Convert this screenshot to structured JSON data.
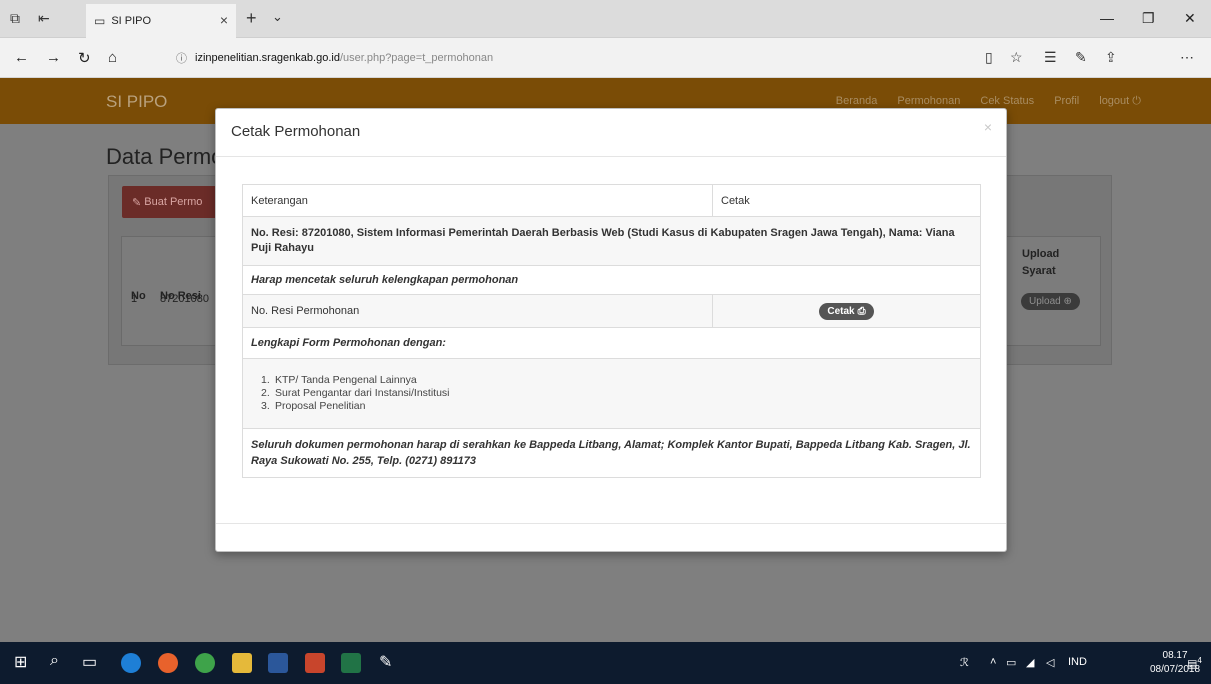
{
  "browser": {
    "tab_title": "SI PIPO",
    "url_host": "izinpenelitian.sragenkab.go.id",
    "url_path": "/user.php?page=t_permohonan"
  },
  "site": {
    "brand": "SI PIPO",
    "nav": [
      "Beranda",
      "Permohonan",
      "Cek Status",
      "Profil",
      "logout"
    ],
    "page_title": "Data Permo",
    "create_button": "Buat Permo",
    "table": {
      "headers": [
        "No",
        "No Resi",
        "Upload Syarat"
      ],
      "row": {
        "no": "1",
        "resi": "87201080"
      },
      "upload_button": "Upload"
    }
  },
  "modal": {
    "title": "Cetak Permohonan",
    "close": "×",
    "col_keterangan": "Keterangan",
    "col_cetak": "Cetak",
    "resi_line": "No. Resi: 87201080, Sistem Informasi Pemerintah Daerah Berbasis Web (Studi Kasus di Kabupaten Sragen Jawa Tengah), Nama: Viana Puji Rahayu",
    "harap": "Harap mencetak seluruh kelengkapan permohonan",
    "no_resi_label": "No. Resi Permohonan",
    "cetak_button": "Cetak",
    "lengkapi": "Lengkapi Form Permohonan dengan:",
    "documents": [
      {
        "num": "1.",
        "text": "KTP/ Tanda Pengenal Lainnya"
      },
      {
        "num": "2.",
        "text": "Surat Pengantar dari Instansi/Institusi"
      },
      {
        "num": "3.",
        "text": "Proposal Penelitian"
      }
    ],
    "footer_note": "Seluruh dokumen permohonan harap di serahkan ke Bappeda Litbang, Alamat; Komplek Kantor Bupati, Bappeda Litbang Kab. Sragen, Jl. Raya Sukowati No. 255, Telp. (0271) 891173"
  },
  "taskbar": {
    "language": "IND",
    "time": "08.17",
    "date": "08/07/2018",
    "notifications": "4"
  }
}
